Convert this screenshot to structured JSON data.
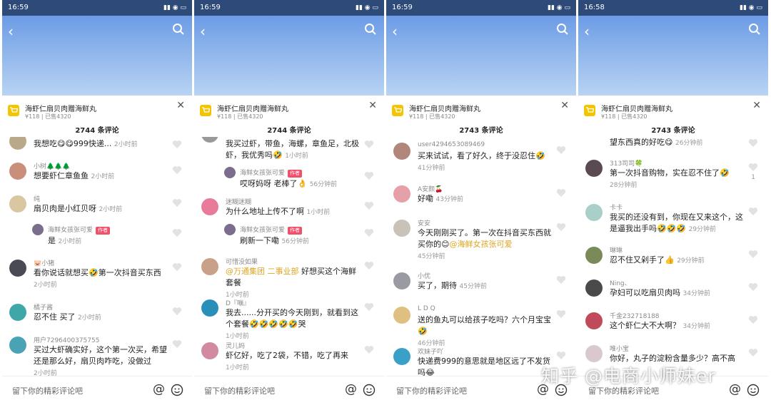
{
  "panels": [
    {
      "time": "16:59",
      "product_title": "海虾仁扇贝肉赠海鲜丸",
      "product_meta": "¥118 | 已售4320",
      "comment_count": "2744 条评论",
      "comments": [
        {
          "name": "",
          "text": "我想吃😋😋999快递...",
          "time": "2小时前",
          "avatar": "#b9a98a"
        },
        {
          "name": "小树🌲🌲🌲",
          "text": "想要虾仁章鱼鱼",
          "time": "2小时前",
          "avatar": "#c98f7a"
        },
        {
          "name": "纯",
          "text": "扇贝肉是小红贝呀",
          "time": "2小时前",
          "avatar": "#d8c7a0"
        },
        {
          "name": "海鲜女孩张可爱",
          "tag": "作者",
          "text": "是",
          "time": "2小时前",
          "reply": true,
          "avatar": "#7b6e8c"
        },
        {
          "name": "🐷小猪",
          "text": "看你说话就想买🤣第一次抖音买东西",
          "time": "2小时前",
          "avatar": "#4a4a52"
        },
        {
          "name": "橘子酱",
          "text": "忍不住 买了",
          "time": "2小时前",
          "avatar": "#3fa7a7"
        },
        {
          "name": "用户7296400375755",
          "text": "买过大虾确实好，这个第一次买，希望还是那么好，扇贝肉咋吃，没做过",
          "time": "2小时前",
          "avatar": "#4aa3b5"
        }
      ]
    },
    {
      "time": "16:59",
      "product_title": "海虾仁扇贝肉赠海鲜丸",
      "product_meta": "¥118 | 已售4320",
      "comment_count": "2744 条评论",
      "comments": [
        {
          "name": "",
          "text": "我买过虾，带鱼，海螺，章鱼足，北极虾，我优秀吗🤣",
          "time": "1小时前",
          "avatar": "#999"
        },
        {
          "name": "海鲜女孩张可爱",
          "tag": "作者",
          "text": "哎呀妈呀 老棒了👌",
          "time": "56分钟前",
          "reply": true,
          "avatar": "#7b6e8c"
        },
        {
          "name": "迷糊迷糊",
          "text": "为什么地址上传不了啊",
          "time": "1小时前",
          "avatar": "#e87a9a"
        },
        {
          "name": "海鲜女孩张可爱",
          "tag": "作者",
          "text": "刷新一下嘞",
          "time": "56分钟前",
          "reply": true,
          "avatar": "#7b6e8c"
        },
        {
          "name": "可惜没如果",
          "mention": "@万通集团 二事业部",
          "text": " 好想买这个海鲜套餐",
          "time": "1小时前",
          "avatar": "#c9a08a"
        },
        {
          "name": "D『嘣』",
          "text": "我去......分开买的今天刚到，就看到这个套餐🤣🤣🤣🤣🤣哭",
          "time": "1小时前",
          "avatar": "#2a8fb8"
        },
        {
          "name": "灵儿妈",
          "text": "虾亿好，吃了2袋，不错，吃了再来",
          "time": "1小时前",
          "avatar": "#d18aa0"
        }
      ]
    },
    {
      "time": "16:59",
      "product_title": "海虾仁扇贝肉赠海鲜丸",
      "product_meta": "¥118 | 已售4320",
      "comment_count": "2743 条评论",
      "comments": [
        {
          "name": "user4294653089469",
          "text": "买来试试，看了好久，终于没忍住🤣",
          "time": "41分钟前",
          "avatar": "#b0877a"
        },
        {
          "name": "A安颜🍒",
          "text": "好嘞",
          "time": "43分钟前",
          "avatar": "#e6a0a8"
        },
        {
          "name": "安安",
          "text": "今天刚刚买了。第一次在抖音买东西就买你的😊",
          "mention": "@海鲜女孩张可爱",
          "time": "45分钟前",
          "avatar": "#c8c2b8"
        },
        {
          "name": "小优",
          "text": "买了，期待",
          "time": "45分钟前",
          "avatar": "#9a9aa2"
        },
        {
          "name": "L D Q",
          "text": "送的鱼丸可以给孩子吃吗？六个月宝宝🤣",
          "time": "46分钟前",
          "avatar": "#e0c080"
        },
        {
          "name": "欢妹子吖",
          "text": "快递费999的意思就是地区远了不发货吗😂",
          "time": "",
          "avatar": "#3aa0c8"
        }
      ]
    },
    {
      "time": "16:58",
      "product_title": "海虾仁扇贝肉赠海鲜丸",
      "product_meta": "¥118 | 已售4320",
      "comment_count": "2743 条评论",
      "comments": [
        {
          "name": "",
          "text": "望东西真的好吃😋",
          "time": "26分钟前",
          "avatar": "#999"
        },
        {
          "name": "313司司🍀",
          "text": "第一次抖音购物，实在忍不住了🤣",
          "time": "28分钟前",
          "likes": "1",
          "avatar": "#5a4a52"
        },
        {
          "name": "卡卡",
          "text": "我买的还没有到，你现在又来这个，这是逼我出手吗🤣🤣🤣",
          "time": "29分钟前",
          "avatar": "#a8d0c8"
        },
        {
          "name": "琳琳",
          "text": "忍不住又剁手了👍",
          "time": "29分钟前",
          "avatar": "#7a8a58"
        },
        {
          "name": "Ning、",
          "text": "孕妇可以吃扇贝肉吗",
          "time": "34分钟前",
          "avatar": "#4a4a4a"
        },
        {
          "name": "千金232718188",
          "text": "这个虾仁大不大啊？",
          "time": "34分钟前",
          "avatar": "#c04a5a"
        },
        {
          "name": "唯小宝",
          "text": "你好，丸子的淀粉含量多少？高不高",
          "time": "",
          "avatar": "#d8c8d0"
        }
      ]
    }
  ],
  "input_placeholder": "留下你的精彩评论吧",
  "watermark": "知乎 @电商小师妹er",
  "colors": {
    "status_bar": "#2d4a78",
    "accent_tag": "#f24f6b",
    "mention": "#e0a520",
    "cart_icon": "#f5c400"
  }
}
